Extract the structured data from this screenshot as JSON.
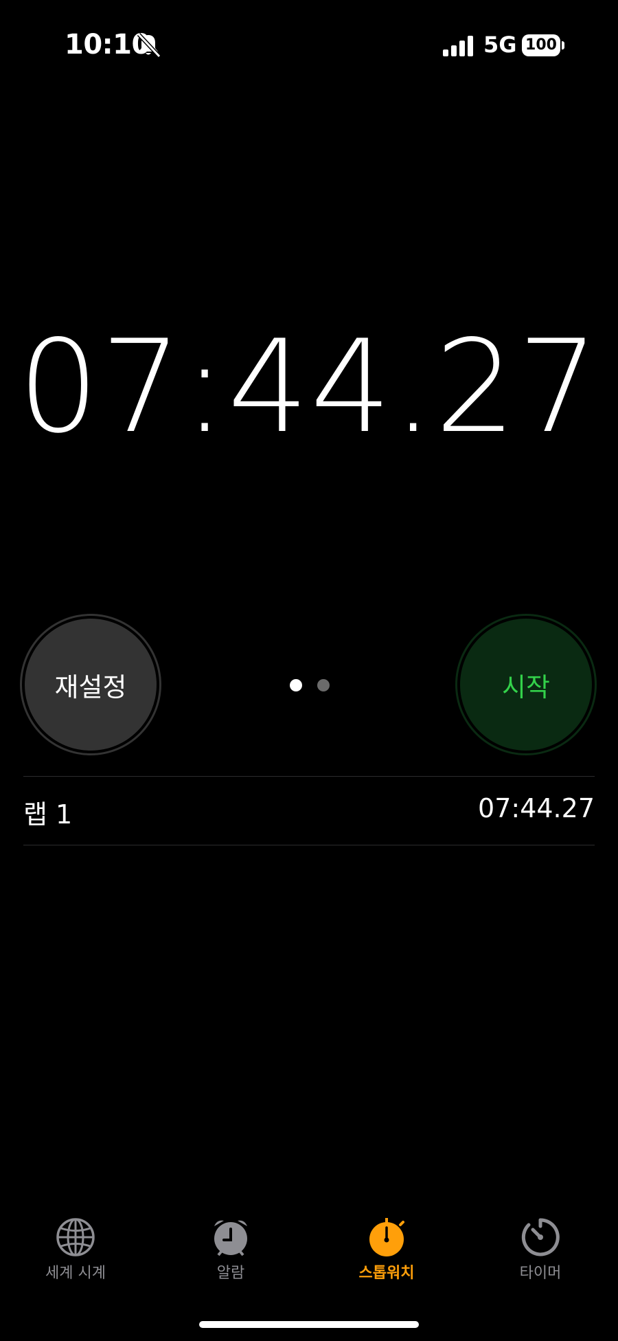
{
  "status_bar": {
    "time": "10:10",
    "network": "5G",
    "battery": "100"
  },
  "stopwatch": {
    "elapsed": "07:44.27",
    "reset_label": "재설정",
    "start_label": "시작"
  },
  "laps": [
    {
      "label": "랩 1",
      "time": "07:44.27"
    }
  ],
  "tabs": [
    {
      "label": "세계 시계",
      "icon": "globe-icon",
      "active": false
    },
    {
      "label": "알람",
      "icon": "alarm-clock-icon",
      "active": false
    },
    {
      "label": "스톱워치",
      "icon": "stopwatch-icon",
      "active": true
    },
    {
      "label": "타이머",
      "icon": "timer-icon",
      "active": false
    }
  ],
  "colors": {
    "accent": "#ff9f0a",
    "start_text": "#33d14a",
    "start_bg": "#0a2a12",
    "reset_bg": "#333333",
    "inactive_tab": "#8e8e93"
  }
}
